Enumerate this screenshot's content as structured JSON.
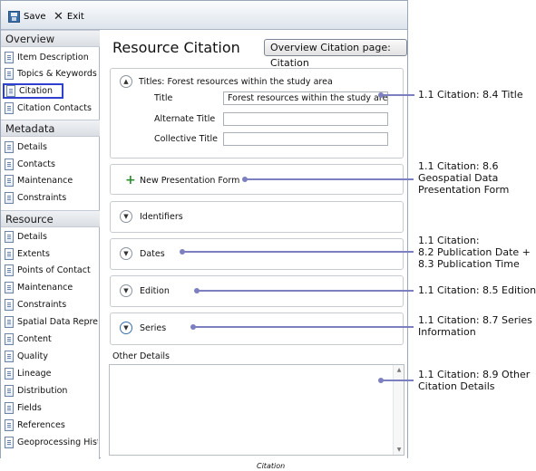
{
  "toolbar": {
    "save_label": "Save",
    "exit_label": "Exit",
    "save_icon": "save-icon",
    "exit_icon": "close-icon"
  },
  "sidebar": {
    "overview": {
      "title": "Overview",
      "items": [
        "Item Description",
        "Topics & Keywords",
        "Citation",
        "Citation Contacts"
      ]
    },
    "metadata": {
      "title": "Metadata",
      "items": [
        "Details",
        "Contacts",
        "Maintenance",
        "Constraints"
      ]
    },
    "resource": {
      "title": "Resource",
      "items": [
        "Details",
        "Extents",
        "Points of Contact",
        "Maintenance",
        "Constraints",
        "Spatial Data Repres",
        "Content",
        "Quality",
        "Lineage",
        "Distribution",
        "Fields",
        "References",
        "Geoprocessing Histo"
      ]
    },
    "selected": "Citation"
  },
  "main": {
    "title": "Resource Citation",
    "tag": "Overview Citation page: Citation",
    "titles_panel": {
      "header": "Titles:  Forest resources within the study area",
      "title_label": "Title",
      "title_value": "Forest resources within the study area",
      "alternate_label": "Alternate Title",
      "alternate_value": "",
      "collective_label": "Collective Title",
      "collective_value": ""
    },
    "presentation_button": "New Presentation Form",
    "sections": [
      "Identifiers",
      "Dates",
      "Edition",
      "Series"
    ],
    "other_details_label": "Other Details",
    "other_details_value": ""
  },
  "annotations": {
    "a1": "1.1 Citation: 8.4 Title",
    "a2": [
      "1.1 Citation: 8.6",
      "Geospatial Data",
      "Presentation Form"
    ],
    "a3": [
      "1.1 Citation:",
      "8.2 Publication Date +",
      "8.3 Publication Time"
    ],
    "a4": "1.1 Citation: 8.5 Edition",
    "a5": [
      "1.1 Citation: 8.7 Series",
      "Information"
    ],
    "a6": [
      "1.1 Citation: 8.9 Other",
      "Citation Details"
    ]
  },
  "caption": "Citation",
  "colors": {
    "connector": "#7c7fc0",
    "selection": "#2f3fd0",
    "accent": "#3a6ea8"
  }
}
